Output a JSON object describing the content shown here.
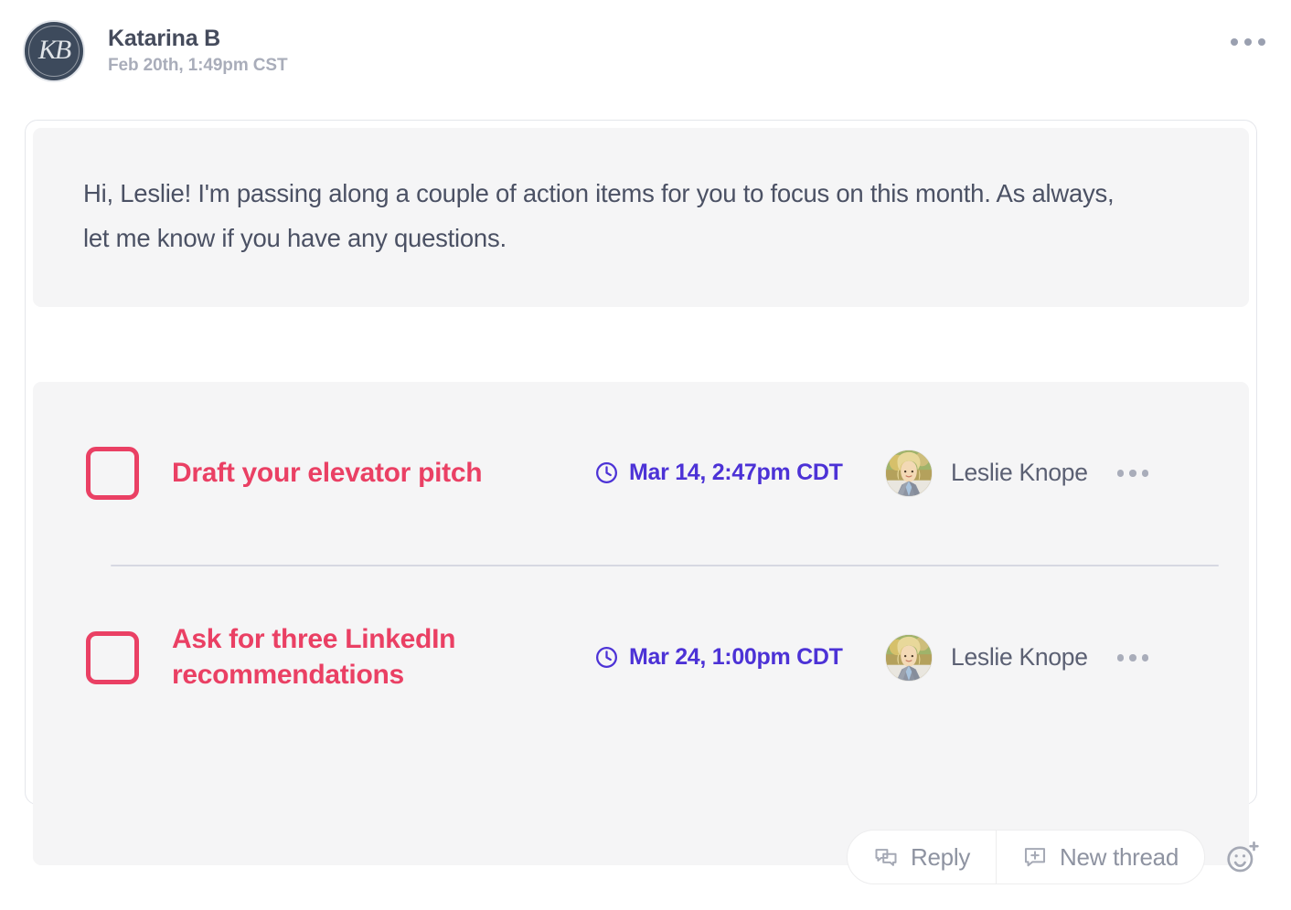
{
  "header": {
    "avatar_initials": "KB",
    "avatar_name": "katarina-b-avatar",
    "sender": "Katarina B",
    "timestamp": "Feb 20th, 1:49pm CST",
    "more_menu_label": "…"
  },
  "message": {
    "body": "Hi, Leslie! I'm passing along a couple of action items for you to focus on this month. As always, let me know if you have any questions."
  },
  "tasks": [
    {
      "title": "Draft your elevator pitch",
      "due": "Mar 14, 2:47pm CDT",
      "assignee": "Leslie Knope",
      "checked": false
    },
    {
      "title": "Ask for three LinkedIn recommendations",
      "due": "Mar 24, 1:00pm CDT",
      "assignee": "Leslie Knope",
      "checked": false
    }
  ],
  "footer": {
    "reply_label": "Reply",
    "new_thread_label": "New thread"
  },
  "colors": {
    "task_accent": "#ea4064",
    "due_accent": "#4c32d6",
    "body_text": "#4b5164",
    "muted_text": "#a9adba",
    "panel_bg": "#f5f5f6",
    "avatar_bg": "#3d4a5c"
  }
}
